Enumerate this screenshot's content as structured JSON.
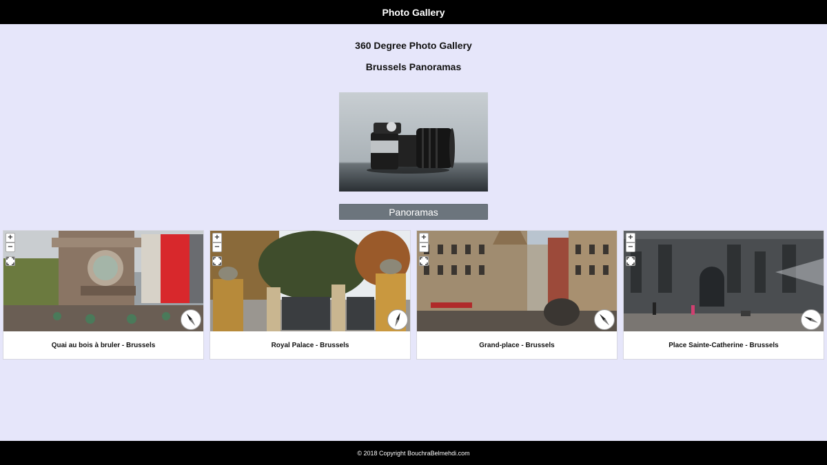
{
  "header": {
    "title": "Photo Gallery"
  },
  "main": {
    "title": "360 Degree Photo Gallery",
    "subtitle": "Brussels Panoramas",
    "panoramas_button": "Panoramas"
  },
  "controls": {
    "zoom_in": "+",
    "zoom_out": "−"
  },
  "cards": [
    {
      "caption": "Quai au bois à bruler - Brussels",
      "compass_angle": -35
    },
    {
      "caption": "Royal Palace - Brussels",
      "compass_angle": 20
    },
    {
      "caption": "Grand-place - Brussels",
      "compass_angle": -40
    },
    {
      "caption": "Place Sainte-Catherine - Brussels",
      "compass_angle": -65
    }
  ],
  "footer": {
    "copyright": "© 2018 Copyright BouchraBelmehdi.com"
  }
}
